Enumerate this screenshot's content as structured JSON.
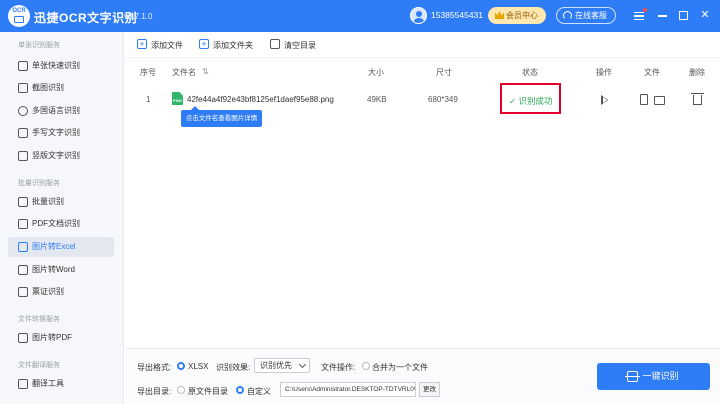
{
  "app": {
    "logo_text": "OCR",
    "title": "迅捷OCR文字识别",
    "version": "v8.7.1.0",
    "phone": "15385545431",
    "vip_label": "会员中心",
    "service_label": "在线客服"
  },
  "sidebar": {
    "groups": [
      {
        "title": "单张识别服务",
        "items": [
          {
            "label": "单张快速识别",
            "icon": "image-icon",
            "active": false
          },
          {
            "label": "截图识别",
            "icon": "crop-icon",
            "active": false
          },
          {
            "label": "多国语言识别",
            "icon": "globe-icon",
            "active": false
          },
          {
            "label": "手写文字识别",
            "icon": "pen-icon",
            "active": false
          },
          {
            "label": "竖版文字识别",
            "icon": "vertical-text-icon",
            "active": false
          }
        ]
      },
      {
        "title": "批量识别服务",
        "items": [
          {
            "label": "批量识别",
            "icon": "batch-icon",
            "active": false
          },
          {
            "label": "PDF文档识别",
            "icon": "pdf-icon",
            "active": false
          },
          {
            "label": "图片转Excel",
            "icon": "excel-icon",
            "active": true
          },
          {
            "label": "图片转Word",
            "icon": "word-icon",
            "active": false
          },
          {
            "label": "票证识别",
            "icon": "ticket-icon",
            "active": false
          }
        ]
      },
      {
        "title": "文件转换服务",
        "items": [
          {
            "label": "图片转PDF",
            "icon": "pdf-convert-icon",
            "active": false
          }
        ]
      },
      {
        "title": "文件翻译服务",
        "items": [
          {
            "label": "翻译工具",
            "icon": "translate-icon",
            "active": false
          }
        ]
      }
    ]
  },
  "toolbar": {
    "add_file": "添加文件",
    "add_folder": "添加文件夹",
    "clear_list": "清空目录"
  },
  "table": {
    "headers": {
      "index": "序号",
      "filename": "文件名",
      "size": "大小",
      "dimensions": "尺寸",
      "status": "状态",
      "operation": "操作",
      "file": "文件",
      "delete": "删除"
    },
    "rows": [
      {
        "index": "1",
        "filename": "42fe44a4f92e43bf8125ef1daef95e88.png",
        "size": "49KB",
        "dimensions": "680*349",
        "status": "识别成功"
      }
    ],
    "tooltip": "点击文件名查看图片详情"
  },
  "bottom": {
    "format_label": "导出格式:",
    "format_value": "XLSX",
    "effect_label": "识别效果:",
    "effect_value": "识别优先",
    "file_op_label": "文件操作:",
    "merge_label": "合并为一个文件",
    "dir_label": "导出目录:",
    "orig_dir_label": "原文件目录",
    "custom_label": "自定义",
    "path": "C:\\Users\\Administrator.DESKTOP-TDTVRL0\\",
    "change_label": "更改",
    "ocr_button": "一键识别"
  },
  "colors": {
    "primary": "#2f7df6",
    "success": "#2eaa52",
    "highlight": "#e4002b"
  }
}
